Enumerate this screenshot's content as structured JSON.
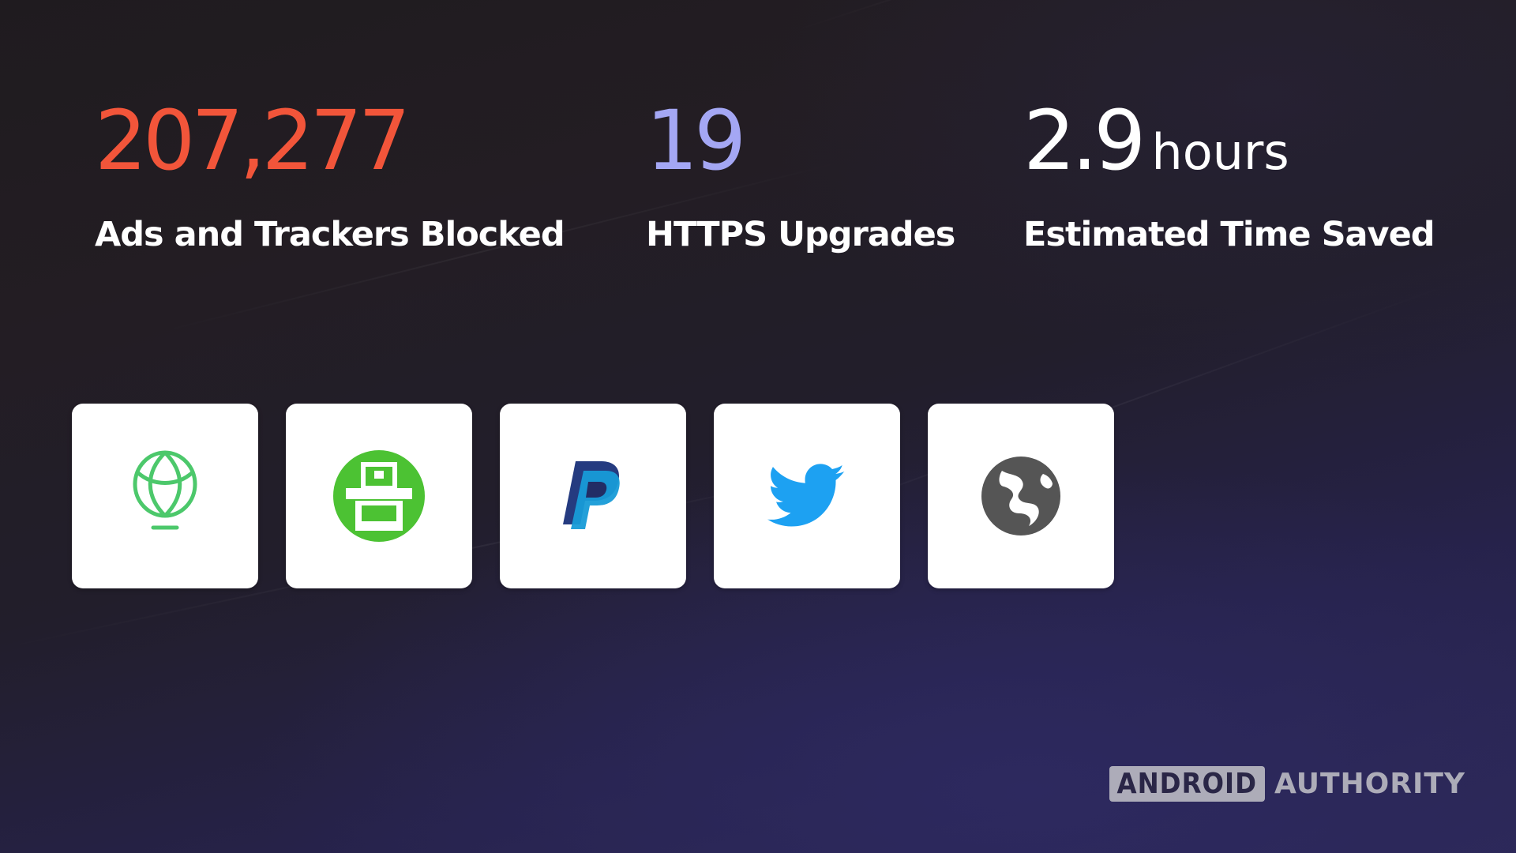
{
  "stats": {
    "ads": {
      "value": "207,277",
      "label": "Ads and Trackers Blocked",
      "color": "#f2553a"
    },
    "https": {
      "value": "19",
      "label": "HTTPS Upgrades",
      "color": "#a4a7f4"
    },
    "time": {
      "value": "2.9",
      "unit": "hours",
      "label": "Estimated Time Saved",
      "color": "#ffffff"
    }
  },
  "top_sites": [
    {
      "icon": "uphold-balloon-icon",
      "color": "#4cc86b"
    },
    {
      "icon": "android-police-icon",
      "color": "#4cc233"
    },
    {
      "icon": "paypal-icon",
      "color": "#253b80"
    },
    {
      "icon": "twitter-icon",
      "color": "#1da1f2"
    },
    {
      "icon": "globe-icon",
      "color": "#555555"
    }
  ],
  "watermark": {
    "boxed": "ANDROID",
    "text": "AUTHORITY"
  }
}
